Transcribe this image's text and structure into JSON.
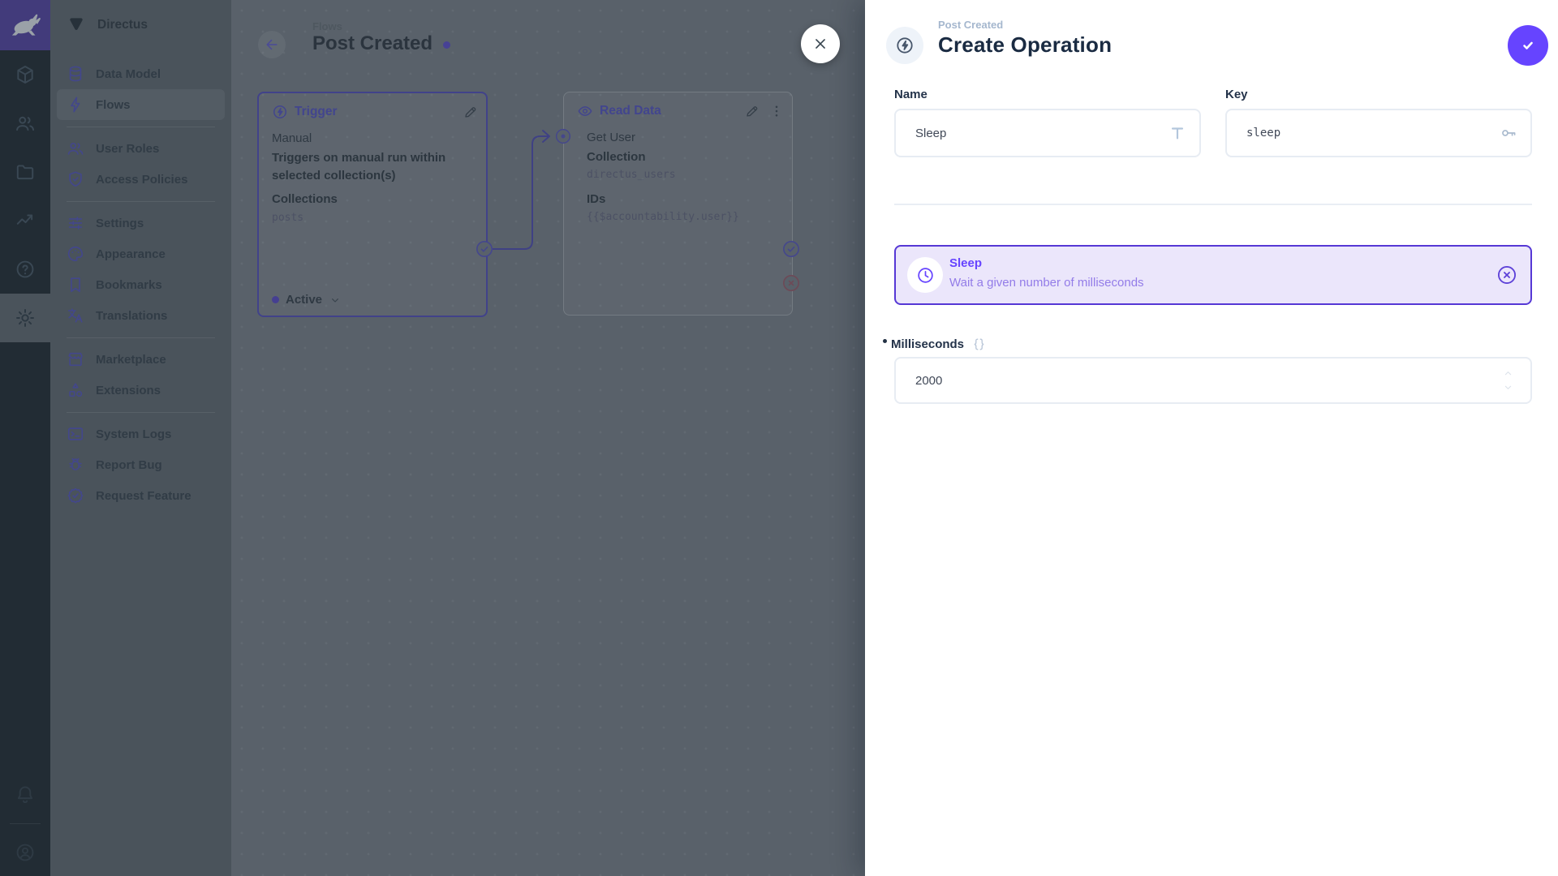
{
  "project": {
    "name": "Directus"
  },
  "sidebar": {
    "items": [
      {
        "label": "Data Model",
        "icon": "database-icon"
      },
      {
        "label": "Flows",
        "icon": "bolt-icon",
        "active": true
      },
      {
        "divider": true
      },
      {
        "label": "User Roles",
        "icon": "users-icon"
      },
      {
        "label": "Access Policies",
        "icon": "shield-icon"
      },
      {
        "divider": true
      },
      {
        "label": "Settings",
        "icon": "tune-icon"
      },
      {
        "label": "Appearance",
        "icon": "palette-icon"
      },
      {
        "label": "Bookmarks",
        "icon": "bookmark-icon"
      },
      {
        "label": "Translations",
        "icon": "translate-icon"
      },
      {
        "divider": true
      },
      {
        "label": "Marketplace",
        "icon": "storefront-icon"
      },
      {
        "label": "Extensions",
        "icon": "extensions-icon"
      },
      {
        "divider": true
      },
      {
        "label": "System Logs",
        "icon": "terminal-icon"
      },
      {
        "label": "Report Bug",
        "icon": "bug-icon"
      },
      {
        "label": "Request Feature",
        "icon": "badge-check-icon"
      }
    ]
  },
  "flow": {
    "breadcrumb": "Flows",
    "title": "Post Created",
    "trigger": {
      "header": "Trigger",
      "type": "Manual",
      "description": "Triggers on manual run within selected collection(s)",
      "collections_label": "Collections",
      "collections_value": "posts",
      "status": "Active"
    },
    "read_data": {
      "header": "Read Data",
      "op_name": "Get User",
      "collection_label": "Collection",
      "collection_value": "directus_users",
      "ids_label": "IDs",
      "ids_value": "{{$accountability.user}}"
    }
  },
  "drawer": {
    "breadcrumb": "Post Created",
    "title": "Create Operation",
    "name_field": {
      "label": "Name",
      "value": "Sleep"
    },
    "key_field": {
      "label": "Key",
      "value": "sleep"
    },
    "operation_card": {
      "name": "Sleep",
      "description": "Wait a given number of milliseconds"
    },
    "milliseconds_field": {
      "label": "Milliseconds",
      "value": "2000"
    }
  },
  "colors": {
    "accent": "#6644ff",
    "module_bar": "#222c34",
    "dimmed_canvas": "#59616a",
    "operation_card_bg": "#ebe6fb"
  }
}
